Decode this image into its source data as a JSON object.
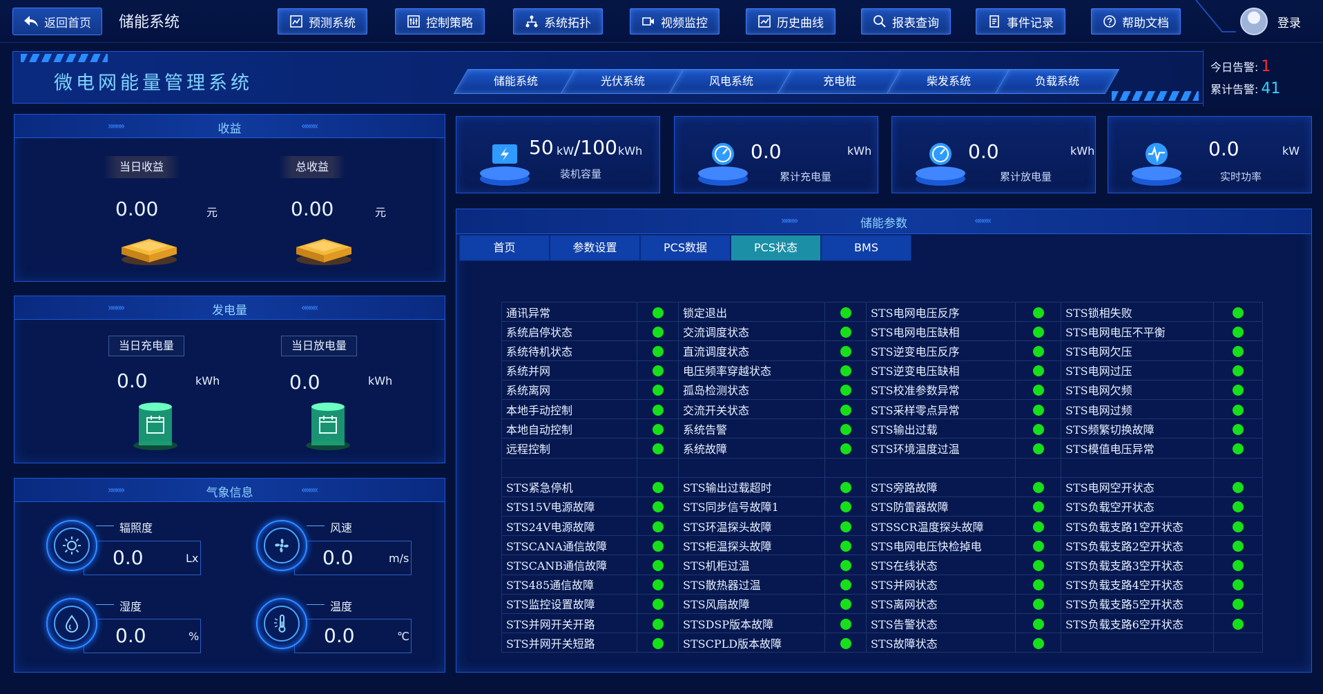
{
  "nav": {
    "back_label": "返回首页",
    "system_title": "储能系统",
    "buttons": [
      {
        "label": "预测系统",
        "icon": "forecast-icon"
      },
      {
        "label": "控制策略",
        "icon": "control-icon"
      },
      {
        "label": "系统拓扑",
        "icon": "topology-icon"
      },
      {
        "label": "视频监控",
        "icon": "video-icon"
      },
      {
        "label": "历史曲线",
        "icon": "chart-icon"
      },
      {
        "label": "报表查询",
        "icon": "search-icon"
      },
      {
        "label": "事件记录",
        "icon": "document-icon"
      },
      {
        "label": "帮助文档",
        "icon": "help-icon"
      }
    ],
    "login_label": "登录"
  },
  "header": {
    "title": "微电网能量管理系统",
    "subtabs": [
      "储能系统",
      "光伏系统",
      "风电系统",
      "充电桩",
      "柴发系统",
      "负载系统"
    ],
    "alarms": {
      "today_label": "今日告警:",
      "today_value": "1",
      "total_label": "累计告警:",
      "total_value": "41",
      "today_color": "#ff2a2a",
      "total_color": "#2fd5ff"
    }
  },
  "income": {
    "title": "收益",
    "daily_label": "当日收益",
    "daily_value": "0.00",
    "daily_unit": "元",
    "total_label": "总收益",
    "total_value": "0.00",
    "total_unit": "元"
  },
  "generation": {
    "title": "发电量",
    "charge_label": "当日充电量",
    "charge_value": "0.0",
    "charge_unit": "kWh",
    "discharge_label": "当日放电量",
    "discharge_value": "0.0",
    "discharge_unit": "kWh"
  },
  "weather": {
    "title": "气象信息",
    "items": [
      {
        "label": "辐照度",
        "value": "0.0",
        "unit": "Lx",
        "icon": "sun-icon"
      },
      {
        "label": "风速",
        "value": "0.0",
        "unit": "m/s",
        "icon": "fan-icon"
      },
      {
        "label": "湿度",
        "value": "0.0",
        "unit": "%",
        "icon": "humidity-icon"
      },
      {
        "label": "温度",
        "value": "0.0",
        "unit": "℃",
        "icon": "thermometer-icon"
      }
    ]
  },
  "cards": [
    {
      "value": "50",
      "unit": "kW",
      "value2": "/100",
      "unit2": "kWh",
      "label": "装机容量",
      "icon": "battery-icon"
    },
    {
      "value": "0.0",
      "unit": "kWh",
      "label": "累计充电量",
      "icon": "gauge-icon"
    },
    {
      "value": "0.0",
      "unit": "kWh",
      "label": "累计放电量",
      "icon": "gauge-icon"
    },
    {
      "value": "0.0",
      "unit": "kW",
      "label": "实时功率",
      "icon": "pulse-icon"
    }
  ],
  "params": {
    "title": "储能参数",
    "tabs": [
      "首页",
      "参数设置",
      "PCS数据",
      "PCS状态",
      "BMS"
    ],
    "active_tab": "PCS状态",
    "rows": [
      [
        "通讯异常",
        "锁定退出",
        "STS电网电压反序",
        "STS锁相失败"
      ],
      [
        "系统启停状态",
        "交流调度状态",
        "STS电网电压缺相",
        "STS电网电压不平衡"
      ],
      [
        "系统待机状态",
        "直流调度状态",
        "STS逆变电压反序",
        "STS电网欠压"
      ],
      [
        "系统并网",
        "电压频率穿越状态",
        "STS逆变电压缺相",
        "STS电网过压"
      ],
      [
        "系统离网",
        "孤岛检测状态",
        "STS校准参数异常",
        "STS电网欠频"
      ],
      [
        "本地手动控制",
        "交流开关状态",
        "STS采样零点异常",
        "STS电网过频"
      ],
      [
        "本地自动控制",
        "系统告警",
        "STS输出过载",
        "STS频繁切换故障"
      ],
      [
        "远程控制",
        "系统故障",
        "STS环境温度过温",
        "STS模值电压异常"
      ],
      [
        "",
        "",
        "",
        ""
      ],
      [
        "STS紧急停机",
        "STS输出过载超时",
        "STS旁路故障",
        "STS电网空开状态"
      ],
      [
        "STS15V电源故障",
        "STS同步信号故障1",
        "STS防雷器故障",
        "STS负载空开状态"
      ],
      [
        "STS24V电源故障",
        "STS环温探头故障",
        "STSSCR温度探头故障",
        "STS负载支路1空开状态"
      ],
      [
        "STSCANA通信故障",
        "STS柜温探头故障",
        "STS电网电压快检掉电",
        "STS负载支路2空开状态"
      ],
      [
        "STSCANB通信故障",
        "STS机柜过温",
        "STS在线状态",
        "STS负载支路3空开状态"
      ],
      [
        "STS485通信故障",
        "STS散热器过温",
        "STS并网状态",
        "STS负载支路4空开状态"
      ],
      [
        "STS监控设置故障",
        "STS风扇故障",
        "STS离网状态",
        "STS负载支路5空开状态"
      ],
      [
        "STS并网开关开路",
        "STSDSP版本故障",
        "STS告警状态",
        "STS负载支路6空开状态"
      ],
      [
        "STS并网开关短路",
        "STSCPLD版本故障",
        "STS故障状态",
        ""
      ]
    ],
    "status_color": "#17e01a"
  }
}
